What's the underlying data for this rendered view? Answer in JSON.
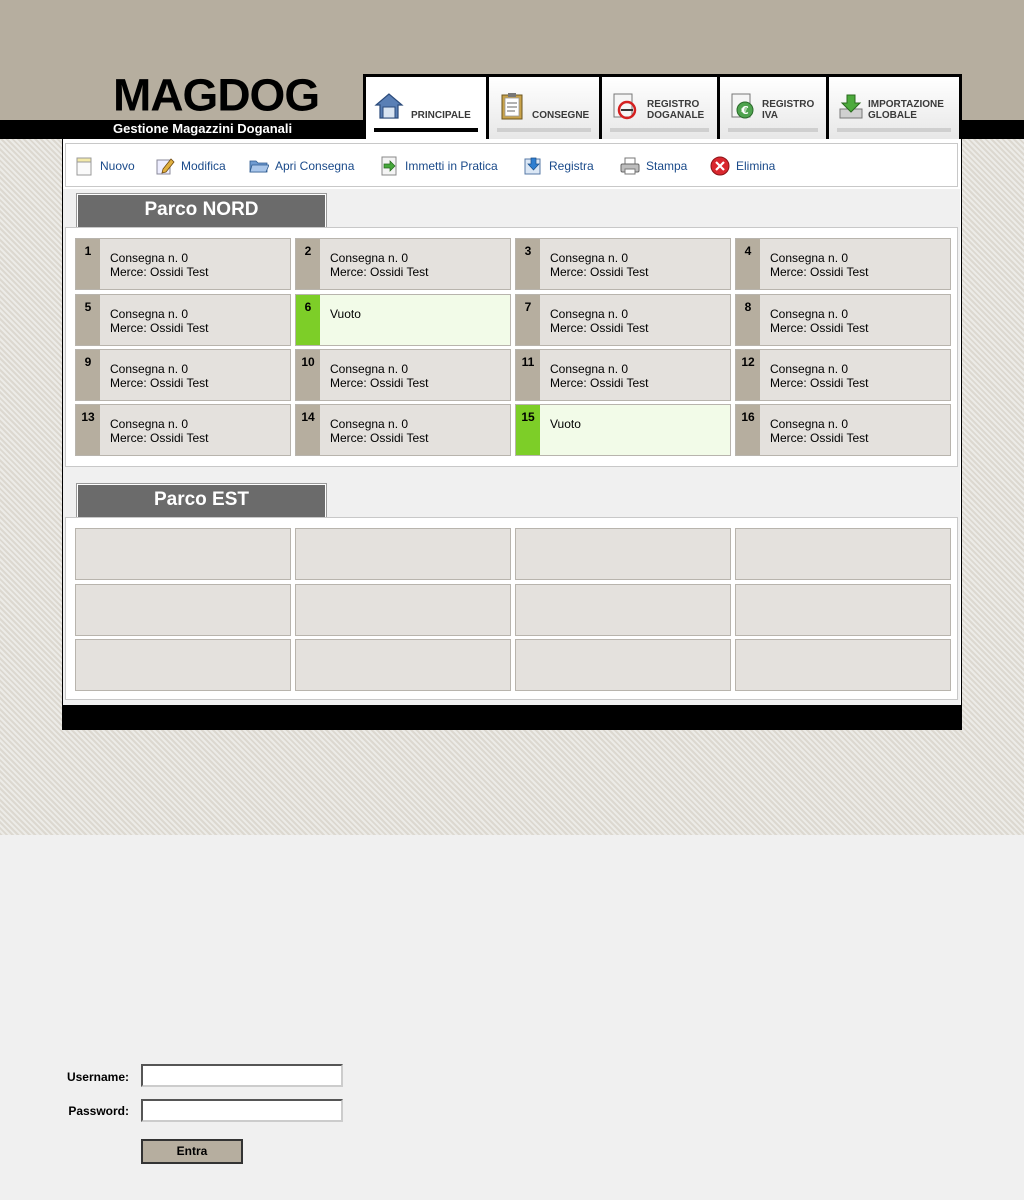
{
  "logo": {
    "title": "MAGDOG",
    "subtitle": "Gestione Magazzini Doganali"
  },
  "tabs": [
    {
      "label": "PRINCIPALE",
      "icon": "home-icon",
      "active": true
    },
    {
      "label": "CONSEGNE",
      "icon": "clipboard-icon",
      "active": false
    },
    {
      "label": "REGISTRO\nDOGANALE",
      "icon": "stamp-icon",
      "active": false
    },
    {
      "label": "REGISTRO\nIVA",
      "icon": "euro-icon",
      "active": false
    },
    {
      "label": "IMPORTAZIONE\nGLOBALE",
      "icon": "download-icon",
      "active": false
    }
  ],
  "toolbar": [
    {
      "label": "Nuovo",
      "icon": "new-document-icon"
    },
    {
      "label": "Modifica",
      "icon": "edit-icon"
    },
    {
      "label": "Apri Consegna",
      "icon": "folder-open-icon"
    },
    {
      "label": "Immetti in Pratica",
      "icon": "import-icon"
    },
    {
      "label": "Registra",
      "icon": "register-icon"
    },
    {
      "label": "Stampa",
      "icon": "printer-icon"
    },
    {
      "label": "Elimina",
      "icon": "delete-icon"
    }
  ],
  "parks": [
    {
      "name": "Parco NORD",
      "slots": [
        {
          "num": "1",
          "line1": "Consegna n. 0",
          "line2": "Merce: Ossidi Test",
          "empty": false
        },
        {
          "num": "2",
          "line1": "Consegna n. 0",
          "line2": "Merce: Ossidi Test",
          "empty": false
        },
        {
          "num": "3",
          "line1": "Consegna n. 0",
          "line2": "Merce: Ossidi Test",
          "empty": false
        },
        {
          "num": "4",
          "line1": "Consegna n. 0",
          "line2": "Merce: Ossidi Test",
          "empty": false
        },
        {
          "num": "5",
          "line1": "Consegna n. 0",
          "line2": "Merce: Ossidi Test",
          "empty": false
        },
        {
          "num": "6",
          "line1": "Vuoto",
          "line2": "",
          "empty": true
        },
        {
          "num": "7",
          "line1": "Consegna n. 0",
          "line2": "Merce: Ossidi Test",
          "empty": false
        },
        {
          "num": "8",
          "line1": "Consegna n. 0",
          "line2": "Merce: Ossidi Test",
          "empty": false
        },
        {
          "num": "9",
          "line1": "Consegna n. 0",
          "line2": "Merce: Ossidi Test",
          "empty": false
        },
        {
          "num": "10",
          "line1": "Consegna n. 0",
          "line2": "Merce: Ossidi Test",
          "empty": false
        },
        {
          "num": "11",
          "line1": "Consegna n. 0",
          "line2": "Merce: Ossidi Test",
          "empty": false
        },
        {
          "num": "12",
          "line1": "Consegna n. 0",
          "line2": "Merce: Ossidi Test",
          "empty": false
        },
        {
          "num": "13",
          "line1": "Consegna n. 0",
          "line2": "Merce: Ossidi Test",
          "empty": false
        },
        {
          "num": "14",
          "line1": "Consegna n. 0",
          "line2": "Merce: Ossidi Test",
          "empty": false
        },
        {
          "num": "15",
          "line1": "Vuoto",
          "line2": "",
          "empty": true
        },
        {
          "num": "16",
          "line1": "Consegna n. 0",
          "line2": "Merce: Ossidi Test",
          "empty": false
        }
      ]
    },
    {
      "name": "Parco EST",
      "blank_rows": 3
    }
  ],
  "login": {
    "username_label": "Username:",
    "password_label": "Password:",
    "username_value": "",
    "password_value": "",
    "submit_label": "Entra"
  },
  "colors": {
    "header_band": "#b6ae9f",
    "slot_strip": "#b6ae9f",
    "empty_strip": "#7dce28",
    "empty_bg": "#f2fbe8",
    "park_header": "#6b6b6b",
    "toolbar_text": "#1a4a8a"
  }
}
